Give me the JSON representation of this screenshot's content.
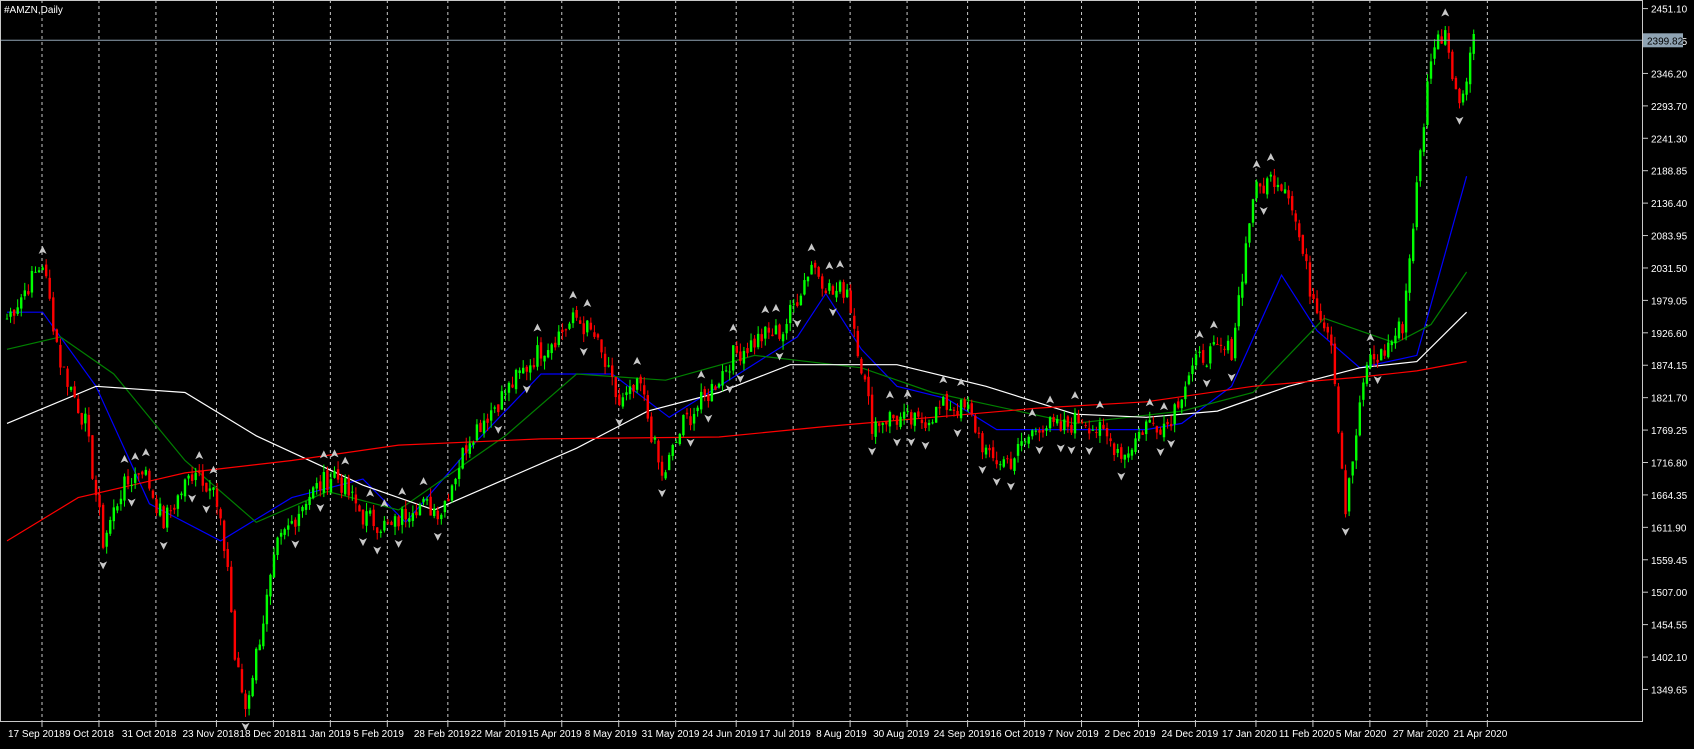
{
  "window": {
    "title": "#AMZN,Daily"
  },
  "colors": {
    "background": "#000000",
    "frame": "#c8c8c8",
    "grid": "#c8c8c8",
    "bull": "#00ff00",
    "bear": "#ff0000",
    "text": "#ffffff",
    "bid_line": "#8fa3b3",
    "price_label_bg": "#8fa3b3",
    "ma_fast": "#0000ff",
    "ma_mid": "#008000",
    "ma_slow": "#ffffff",
    "ma_long": "#ff0000",
    "fractal": "#c8c8c8"
  },
  "chart_data": {
    "type": "candlestick",
    "symbol": "#AMZN",
    "timeframe": "Daily",
    "ylim": [
      1297.0,
      2465.0
    ],
    "current_price": 2399.82,
    "current_price_label": "2399.82",
    "y_ticks": [
      "2451.10",
      "2398.65",
      "2346.20",
      "2293.70",
      "2241.30",
      "2188.85",
      "2136.40",
      "2083.95",
      "2031.50",
      "1979.05",
      "1926.60",
      "1874.15",
      "1821.70",
      "1769.25",
      "1716.80",
      "1664.35",
      "1611.90",
      "1559.45",
      "1507.00",
      "1454.55",
      "1402.10",
      "1349.65"
    ],
    "x_ticks": [
      "17 Sep 2018",
      "9 Oct 2018",
      "31 Oct 2018",
      "23 Nov 2018",
      "18 Dec 2018",
      "11 Jan 2019",
      "5 Feb 2019",
      "28 Feb 2019",
      "22 Mar 2019",
      "15 Apr 2019",
      "8 May 2019",
      "31 May 2019",
      "24 Jun 2019",
      "17 Jul 2019",
      "8 Aug 2019",
      "30 Aug 2019",
      "24 Sep 2019",
      "16 Oct 2019",
      "7 Nov 2019",
      "2 Dec 2019",
      "24 Dec 2019",
      "17 Jan 2020",
      "11 Feb 2020",
      "5 Mar 2020",
      "27 Mar 2020",
      "21 Apr 2020"
    ],
    "anchors": [
      [
        0,
        1950
      ],
      [
        10,
        2040
      ],
      [
        15,
        1880
      ],
      [
        22,
        1780
      ],
      [
        27,
        1590
      ],
      [
        32,
        1670
      ],
      [
        38,
        1710
      ],
      [
        44,
        1620
      ],
      [
        53,
        1710
      ],
      [
        58,
        1670
      ],
      [
        62,
        1550
      ],
      [
        64,
        1400
      ],
      [
        67,
        1320
      ],
      [
        76,
        1580
      ],
      [
        84,
        1660
      ],
      [
        92,
        1700
      ],
      [
        100,
        1630
      ],
      [
        108,
        1610
      ],
      [
        114,
        1650
      ],
      [
        122,
        1640
      ],
      [
        130,
        1760
      ],
      [
        140,
        1830
      ],
      [
        150,
        1900
      ],
      [
        160,
        1950
      ],
      [
        165,
        1920
      ],
      [
        172,
        1810
      ],
      [
        178,
        1840
      ],
      [
        184,
        1690
      ],
      [
        190,
        1780
      ],
      [
        196,
        1820
      ],
      [
        204,
        1890
      ],
      [
        212,
        1920
      ],
      [
        218,
        1930
      ],
      [
        226,
        2040
      ],
      [
        232,
        1990
      ],
      [
        236,
        2000
      ],
      [
        243,
        1780
      ],
      [
        248,
        1790
      ],
      [
        256,
        1780
      ],
      [
        264,
        1810
      ],
      [
        270,
        1800
      ],
      [
        276,
        1720
      ],
      [
        282,
        1720
      ],
      [
        290,
        1780
      ],
      [
        296,
        1770
      ],
      [
        302,
        1790
      ],
      [
        308,
        1760
      ],
      [
        314,
        1730
      ],
      [
        320,
        1780
      ],
      [
        326,
        1780
      ],
      [
        332,
        1860
      ],
      [
        336,
        1890
      ],
      [
        344,
        1900
      ],
      [
        350,
        2150
      ],
      [
        356,
        2180
      ],
      [
        360,
        2160
      ],
      [
        366,
        2000
      ],
      [
        372,
        1920
      ],
      [
        376,
        1640
      ],
      [
        382,
        1880
      ],
      [
        386,
        1890
      ],
      [
        392,
        1940
      ],
      [
        400,
        2380
      ],
      [
        404,
        2420
      ],
      [
        408,
        2290
      ],
      [
        412,
        2410
      ]
    ],
    "moving_averages": [
      {
        "color": "blue",
        "points": [
          [
            0,
            1960
          ],
          [
            10,
            1960
          ],
          [
            25,
            1840
          ],
          [
            40,
            1650
          ],
          [
            60,
            1590
          ],
          [
            80,
            1660
          ],
          [
            100,
            1690
          ],
          [
            112,
            1620
          ],
          [
            130,
            1740
          ],
          [
            150,
            1860
          ],
          [
            170,
            1860
          ],
          [
            186,
            1790
          ],
          [
            200,
            1840
          ],
          [
            222,
            1920
          ],
          [
            230,
            1990
          ],
          [
            240,
            1900
          ],
          [
            250,
            1840
          ],
          [
            264,
            1820
          ],
          [
            278,
            1770
          ],
          [
            300,
            1770
          ],
          [
            320,
            1770
          ],
          [
            330,
            1780
          ],
          [
            344,
            1840
          ],
          [
            358,
            2020
          ],
          [
            368,
            1930
          ],
          [
            380,
            1870
          ],
          [
            396,
            1890
          ],
          [
            410,
            2180
          ]
        ]
      },
      {
        "color": "green",
        "points": [
          [
            0,
            1900
          ],
          [
            15,
            1920
          ],
          [
            30,
            1860
          ],
          [
            50,
            1720
          ],
          [
            70,
            1620
          ],
          [
            90,
            1670
          ],
          [
            110,
            1640
          ],
          [
            140,
            1760
          ],
          [
            160,
            1860
          ],
          [
            185,
            1850
          ],
          [
            210,
            1890
          ],
          [
            240,
            1870
          ],
          [
            260,
            1830
          ],
          [
            300,
            1780
          ],
          [
            330,
            1800
          ],
          [
            350,
            1830
          ],
          [
            370,
            1950
          ],
          [
            390,
            1910
          ],
          [
            400,
            1940
          ],
          [
            410,
            2025
          ]
        ]
      },
      {
        "color": "white",
        "points": [
          [
            0,
            1780
          ],
          [
            25,
            1840
          ],
          [
            50,
            1830
          ],
          [
            70,
            1760
          ],
          [
            100,
            1680
          ],
          [
            120,
            1640
          ],
          [
            140,
            1690
          ],
          [
            160,
            1740
          ],
          [
            180,
            1800
          ],
          [
            200,
            1830
          ],
          [
            220,
            1875
          ],
          [
            250,
            1875
          ],
          [
            275,
            1840
          ],
          [
            300,
            1795
          ],
          [
            320,
            1790
          ],
          [
            340,
            1800
          ],
          [
            360,
            1840
          ],
          [
            380,
            1870
          ],
          [
            396,
            1880
          ],
          [
            410,
            1960
          ]
        ]
      },
      {
        "color": "red",
        "points": [
          [
            0,
            1590
          ],
          [
            20,
            1660
          ],
          [
            50,
            1700
          ],
          [
            80,
            1720
          ],
          [
            110,
            1745
          ],
          [
            150,
            1755
          ],
          [
            200,
            1758
          ],
          [
            230,
            1775
          ],
          [
            260,
            1790
          ],
          [
            290,
            1805
          ],
          [
            320,
            1815
          ],
          [
            350,
            1840
          ],
          [
            380,
            1855
          ],
          [
            396,
            1865
          ],
          [
            410,
            1880
          ]
        ]
      }
    ]
  }
}
